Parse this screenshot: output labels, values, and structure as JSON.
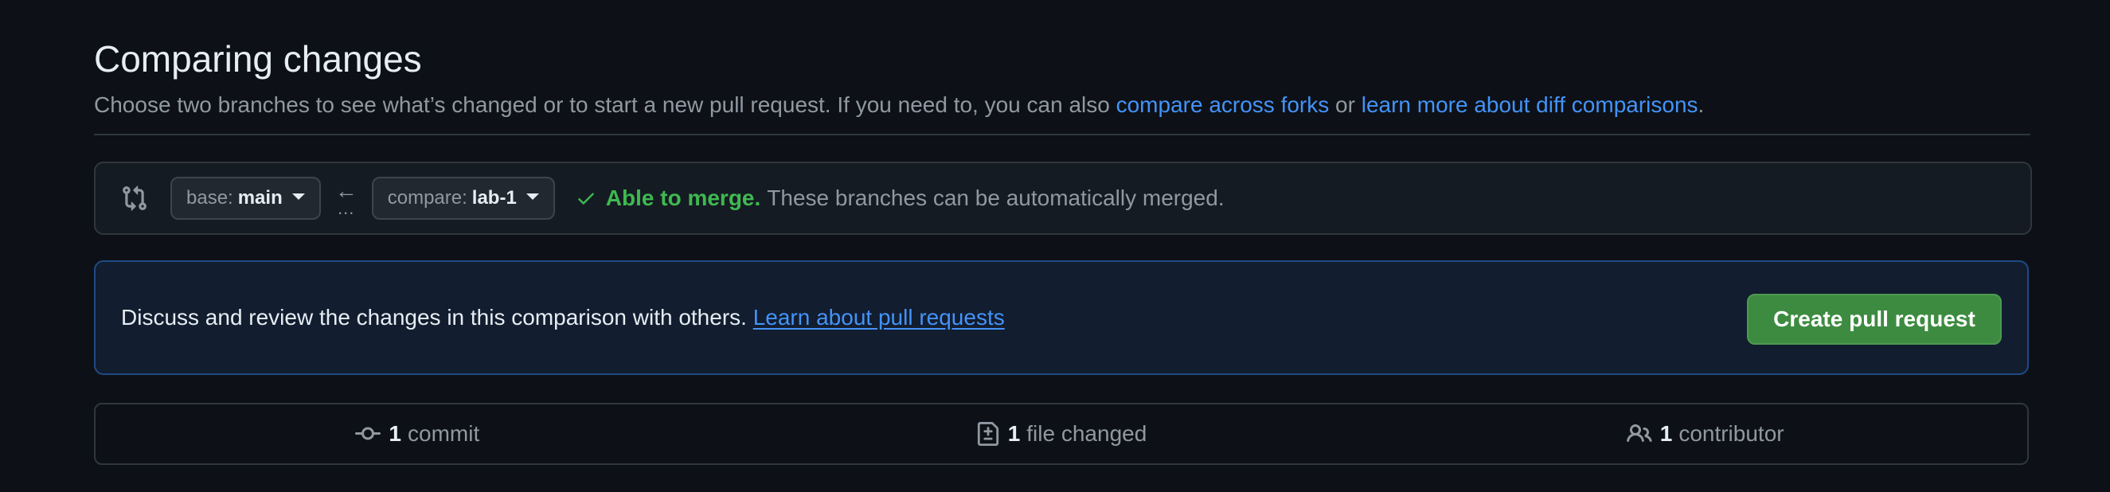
{
  "header": {
    "title": "Comparing changes",
    "subtitle_text": "Choose two branches to see what’s changed or to start a new pull request. If you need to, you can also ",
    "compare_forks_link": "compare across forks",
    "subtitle_or": " or ",
    "diff_link": "learn more about diff comparisons",
    "subtitle_end": "."
  },
  "compare_bar": {
    "base_label": "base:",
    "base_branch": "main",
    "compare_label": "compare:",
    "compare_branch": "lab-1",
    "arrow": "←",
    "dots": "...",
    "merge_status": "Able to merge.",
    "merge_message": "These branches can be automatically merged."
  },
  "discuss": {
    "text": "Discuss and review the changes in this comparison with others. ",
    "link": "Learn about pull requests",
    "button": "Create pull request"
  },
  "stats": {
    "commits_count": "1",
    "commits_label": "commit",
    "files_count": "1",
    "files_label": "file changed",
    "contributors_count": "1",
    "contributors_label": "contributor"
  },
  "colors": {
    "background": "#0d1117",
    "link": "#4493f8",
    "success": "#3fb950",
    "button_green": "#3d8b40",
    "muted_text": "#9198a1"
  }
}
